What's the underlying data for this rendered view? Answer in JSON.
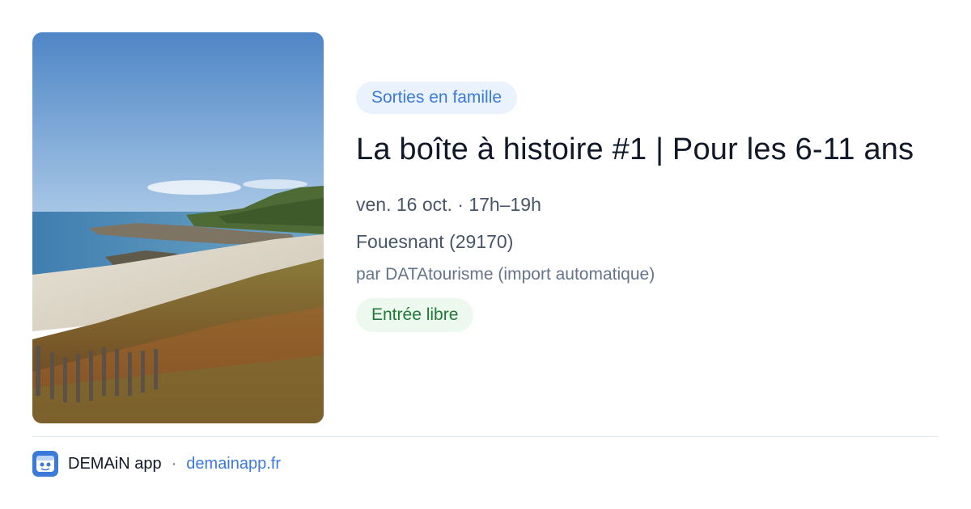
{
  "event": {
    "image_alt": "Plage en Bretagne",
    "category": "Sorties en famille",
    "title": "La boîte à histoire #1 | Pour les 6-11 ans",
    "date_time": "ven. 16 oct. · 17h–19h",
    "location": "Fouesnant (29170)",
    "source": "par DATAtourisme (import automatique)",
    "price": "Entrée libre"
  },
  "footer": {
    "app_name": "DEMAiN app",
    "separator": "·",
    "url": "demainapp.fr",
    "logo_icon": "demain-app-logo-icon"
  },
  "colors": {
    "accent": "#3b7ad9",
    "category_bg": "#eaf2fd",
    "price_text": "#1f7a36",
    "price_bg": "#edf9ef"
  }
}
